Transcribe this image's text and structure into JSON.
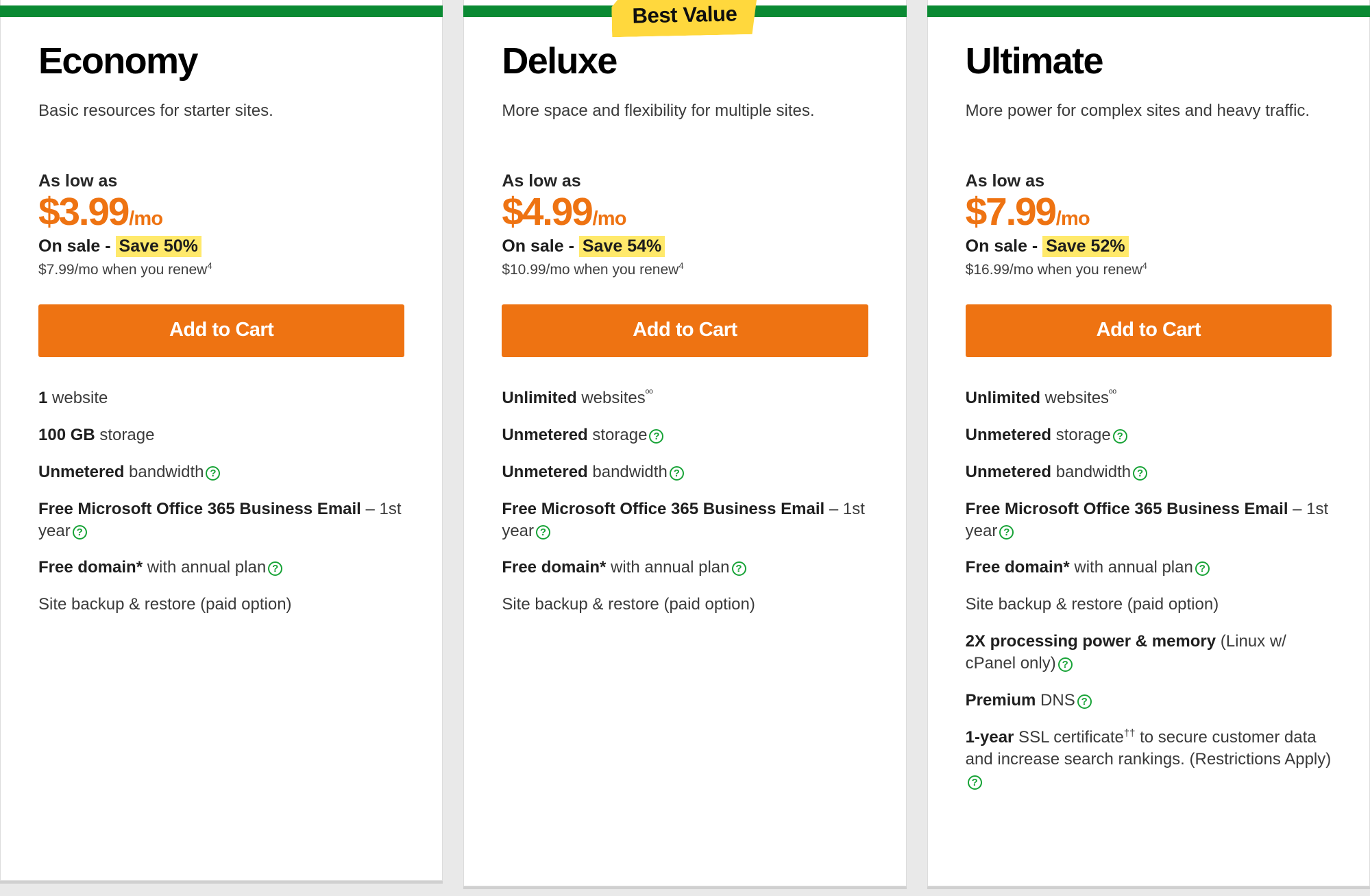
{
  "page": {
    "background_color": "#e9e9e9",
    "accent_green": "#0a8a33",
    "accent_orange": "#ee7312",
    "highlight_yellow": "#ffe96b",
    "badge_yellow": "#ffd83d"
  },
  "badge": {
    "label": "Best Value"
  },
  "labels": {
    "as_low_as": "As low as",
    "on_sale_prefix": "On sale - ",
    "cta": "Add to Cart",
    "help_icon": "question-circle-icon"
  },
  "plans": [
    {
      "id": "economy",
      "title": "Economy",
      "description": "Basic resources for starter sites.",
      "as_low_as": "As low as",
      "price": "$3.99",
      "price_period": "/mo",
      "on_sale_prefix": "On sale - ",
      "save_badge": "Save 50%",
      "renew_text": "$7.99/mo when you renew",
      "renew_sup": "4",
      "cta": "Add to Cart",
      "featured": false,
      "features": [
        {
          "bold": "1",
          "rest": " website",
          "help": false
        },
        {
          "bold": "100 GB",
          "rest": " storage",
          "help": false
        },
        {
          "bold": "Unmetered",
          "rest": " bandwidth",
          "help": true
        },
        {
          "bold": "Free Microsoft Office 365 Business Email",
          "rest": " – 1st year",
          "help": true
        },
        {
          "bold": "Free domain*",
          "rest": " with annual plan",
          "help": true
        },
        {
          "bold": "",
          "rest": "Site backup & restore (paid option)",
          "help": false
        }
      ]
    },
    {
      "id": "deluxe",
      "title": "Deluxe",
      "description": "More space and flexibility for multiple sites.",
      "as_low_as": "As low as",
      "price": "$4.99",
      "price_period": "/mo",
      "on_sale_prefix": "On sale - ",
      "save_badge": "Save 54%",
      "renew_text": "$10.99/mo when you renew",
      "renew_sup": "4",
      "cta": "Add to Cart",
      "featured": true,
      "features": [
        {
          "bold": "Unlimited",
          "rest": " websites",
          "sup": "ºº",
          "help": false
        },
        {
          "bold": "Unmetered",
          "rest": " storage",
          "help": true
        },
        {
          "bold": "Unmetered",
          "rest": " bandwidth",
          "help": true
        },
        {
          "bold": "Free Microsoft Office 365 Business Email",
          "rest": " – 1st year",
          "help": true
        },
        {
          "bold": "Free domain*",
          "rest": " with annual plan",
          "help": true
        },
        {
          "bold": "",
          "rest": "Site backup & restore (paid option)",
          "help": false
        }
      ]
    },
    {
      "id": "ultimate",
      "title": "Ultimate",
      "description": "More power for complex sites and heavy traffic.",
      "as_low_as": "As low as",
      "price": "$7.99",
      "price_period": "/mo",
      "on_sale_prefix": "On sale - ",
      "save_badge": "Save 52%",
      "renew_text": "$16.99/mo when you renew",
      "renew_sup": "4",
      "cta": "Add to Cart",
      "featured": false,
      "features": [
        {
          "bold": "Unlimited",
          "rest": " websites",
          "sup": "ºº",
          "help": false
        },
        {
          "bold": "Unmetered",
          "rest": " storage",
          "help": true
        },
        {
          "bold": "Unmetered",
          "rest": " bandwidth",
          "help": true
        },
        {
          "bold": "Free Microsoft Office 365 Business Email",
          "rest": " – 1st year",
          "help": true
        },
        {
          "bold": "Free domain*",
          "rest": " with annual plan",
          "help": true
        },
        {
          "bold": "",
          "rest": "Site backup & restore (paid option)",
          "help": false
        },
        {
          "bold": "2X processing power & memory",
          "rest": " (Linux w/ cPanel only)",
          "help": true
        },
        {
          "bold": "Premium",
          "rest": " DNS",
          "help": true
        },
        {
          "bold": "1-year",
          "rest": " SSL certificate",
          "sup": "††",
          "rest2": " to secure customer data and increase search rankings. (Restrictions Apply)",
          "help": true
        }
      ]
    }
  ]
}
